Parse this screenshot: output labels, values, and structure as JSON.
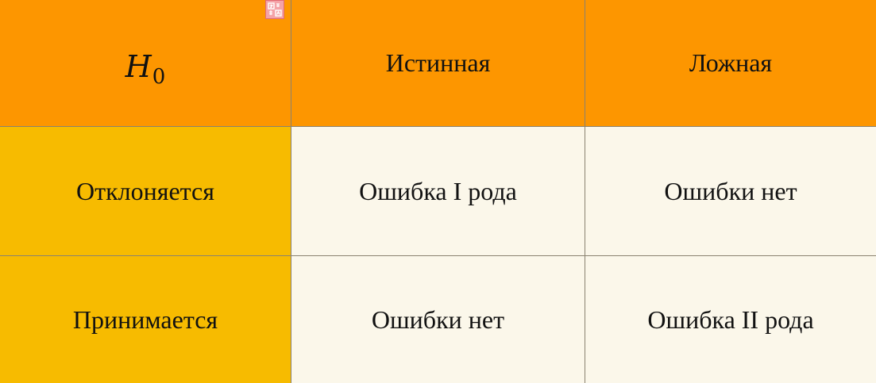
{
  "table": {
    "corner": {
      "symbol": "H",
      "subscript": "0"
    },
    "columns": [
      "Истинная",
      "Ложная"
    ],
    "rows": [
      {
        "label": "Отклоняется",
        "cells": [
          "Ошибка I рода",
          "Ошибки нет"
        ]
      },
      {
        "label": "Принимается",
        "cells": [
          "Ошибки нет",
          "Ошибка II рода"
        ]
      }
    ]
  },
  "colors": {
    "header_bg": "#fd9600",
    "row_header_bg": "#f7bb00",
    "body_bg": "#fbf7ea",
    "grid_line": "#8a8270"
  },
  "icons": {
    "overlay": "translate-icon"
  }
}
